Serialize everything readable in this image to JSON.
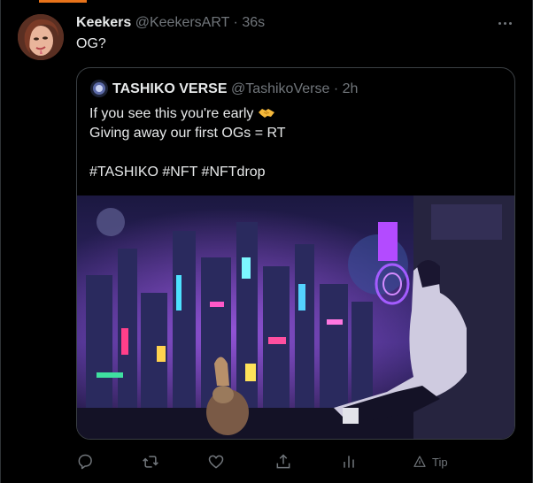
{
  "tweet": {
    "author": {
      "name": "Keekers",
      "handle": "@KeekersART",
      "separator": "·",
      "time": "36s"
    },
    "text": "OG?",
    "avatar_icon": "profile-avatar-illustration"
  },
  "quote": {
    "author": {
      "name": "TASHIKO VERSE",
      "handle": "@TashikoVerse",
      "separator": "·",
      "time": "2h"
    },
    "lines": [
      "If you see this you're early",
      "Giving away our first OGs = RT",
      "",
      "#TASHIKO #NFT #NFTdrop"
    ],
    "emoji_icon": "handshake-emoji",
    "media_description_icon": "cyberpunk-city-artwork"
  },
  "actions": {
    "reply_icon": "reply-icon",
    "retweet_icon": "retweet-icon",
    "like_icon": "heart-icon",
    "share_icon": "share-icon",
    "analytics_icon": "analytics-icon",
    "tip_label": "Tip"
  },
  "colors": {
    "background": "#000000",
    "text": "#e7e9ea",
    "muted": "#71767b",
    "border": "#3a3f43",
    "accent": "#e8731a"
  }
}
